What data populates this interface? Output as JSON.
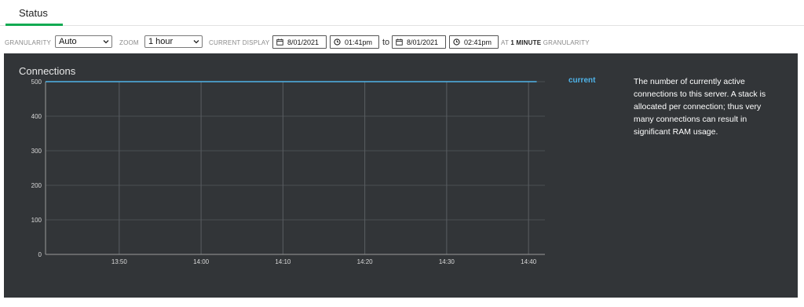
{
  "tabs": [
    {
      "label": "Status",
      "active": true
    }
  ],
  "toolbar": {
    "granularity_label": "GRANULARITY",
    "granularity_value": "Auto",
    "zoom_label": "ZOOM",
    "zoom_value": "1 hour",
    "current_display_label": "CURRENT DISPLAY",
    "start_date": "8/01/2021",
    "start_time": "01:41pm",
    "to_label": "to",
    "end_date": "8/01/2021",
    "end_time": "02:41pm",
    "at_prefix": "AT",
    "at_value": "1 MINUTE",
    "at_suffix": "GRANULARITY"
  },
  "panel": {
    "title": "Connections",
    "legend_label": "current",
    "description": "The number of currently active connections to this server. A stack is allocated per connection; thus very many connections can result in significant RAM usage."
  },
  "colors": {
    "accent": "#13aa52",
    "series": "#4fb3e8",
    "panel_bg": "#323538"
  },
  "chart_data": {
    "type": "line",
    "title": "Connections",
    "xlabel": "",
    "ylabel": "",
    "ylim": [
      0,
      500
    ],
    "yticks": [
      0,
      100,
      200,
      300,
      400,
      500
    ],
    "xticks": [
      "13:50",
      "14:00",
      "14:10",
      "14:20",
      "14:30",
      "14:40"
    ],
    "grid": true,
    "legend": "right",
    "series": [
      {
        "name": "current",
        "x": [
          "13:41",
          "14:41"
        ],
        "y": [
          500,
          500
        ]
      }
    ]
  }
}
